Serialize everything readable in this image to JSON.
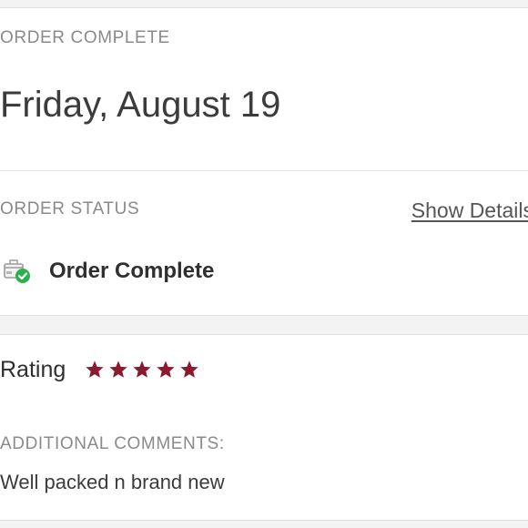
{
  "order": {
    "complete_label": "ORDER COMPLETE",
    "date": "Friday, August 19"
  },
  "status": {
    "section_label": "ORDER STATUS",
    "show_details": "Show Details",
    "text": "Order Complete",
    "icon": "package-check-icon",
    "check_color": "#2bb24c"
  },
  "rating": {
    "label": "Rating",
    "value": 5,
    "max": 5,
    "star_color": "#8b1a2f"
  },
  "comments": {
    "label": "ADDITIONAL COMMENTS:",
    "text": "Well packed n brand new"
  }
}
